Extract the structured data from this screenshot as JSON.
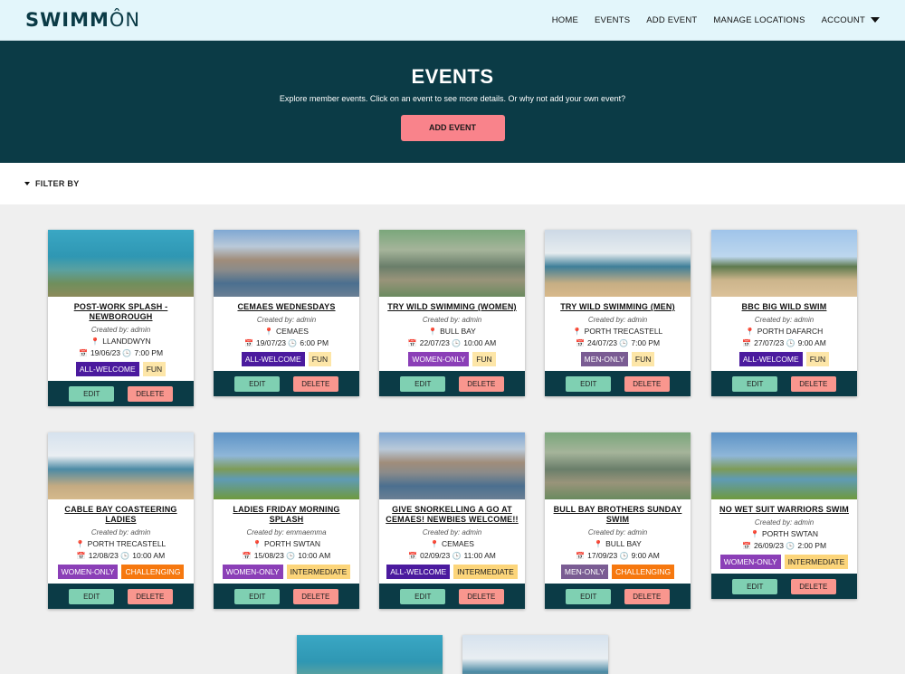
{
  "nav": {
    "logo_bold": "SWIMM",
    "logo_light": "ÔN",
    "links": [
      "HOME",
      "EVENTS",
      "ADD EVENT",
      "MANAGE LOCATIONS",
      "ACCOUNT"
    ]
  },
  "hero": {
    "title": "EVENTS",
    "subtitle": "Explore member events. Click on an event to see more details. Or why not add your own event?",
    "button": "ADD EVENT"
  },
  "filter": {
    "label": "FILTER BY"
  },
  "labels": {
    "edit": "EDIT",
    "delete": "DELETE"
  },
  "events": [
    {
      "title": "POST-WORK SPLASH - NEWBOROUGH",
      "creator": "Created by: admin",
      "location": "LLANDDWYN",
      "date": "19/06/23",
      "time": "7:00 PM",
      "tags": [
        "ALL-WELCOME",
        "FUN"
      ]
    },
    {
      "title": "CEMAES WEDNESDAYS",
      "creator": "Created by: admin",
      "location": "CEMAES",
      "date": "19/07/23",
      "time": "6:00 PM",
      "tags": [
        "ALL-WELCOME",
        "FUN"
      ]
    },
    {
      "title": "TRY WILD SWIMMING (WOMEN)",
      "creator": "Created by: admin",
      "location": "BULL BAY",
      "date": "22/07/23",
      "time": "10:00 AM",
      "tags": [
        "WOMEN-ONLY",
        "FUN"
      ]
    },
    {
      "title": "TRY WILD SWIMMING (MEN)",
      "creator": "Created by: admin",
      "location": "PORTH TRECASTELL",
      "date": "24/07/23",
      "time": "7:00 PM",
      "tags": [
        "MEN-ONLY",
        "FUN"
      ]
    },
    {
      "title": "BBC BIG WILD SWIM",
      "creator": "Created by: admin",
      "location": "PORTH DAFARCH",
      "date": "27/07/23",
      "time": "9:00 AM",
      "tags": [
        "ALL-WELCOME",
        "FUN"
      ]
    },
    {
      "title": "CABLE BAY COASTEERING LADIES",
      "creator": "Created by: admin",
      "location": "PORTH TRECASTELL",
      "date": "12/08/23",
      "time": "10:00 AM",
      "tags": [
        "WOMEN-ONLY",
        "CHALLENGING"
      ]
    },
    {
      "title": "LADIES FRIDAY MORNING SPLASH",
      "creator": "Created by: emmaemma",
      "location": "PORTH SWTAN",
      "date": "15/08/23",
      "time": "10:00 AM",
      "tags": [
        "WOMEN-ONLY",
        "INTERMEDIATE"
      ]
    },
    {
      "title": "GIVE SNORKELLING A GO AT CEMAES! NEWBIES WELCOME!!",
      "creator": "Created by: admin",
      "location": "CEMAES",
      "date": "02/09/23",
      "time": "11:00 AM",
      "tags": [
        "ALL-WELCOME",
        "INTERMEDIATE"
      ]
    },
    {
      "title": "BULL BAY BROTHERS SUNDAY SWIM",
      "creator": "Created by: admin",
      "location": "BULL BAY",
      "date": "17/09/23",
      "time": "9:00 AM",
      "tags": [
        "MEN-ONLY",
        "CHALLENGING"
      ]
    },
    {
      "title": "NO WET SUIT WARRIORS SWIM",
      "creator": "Created by: admin",
      "location": "PORTH SWTAN",
      "date": "26/09/23",
      "time": "2:00 PM",
      "tags": [
        "WOMEN-ONLY",
        "INTERMEDIATE"
      ]
    }
  ]
}
